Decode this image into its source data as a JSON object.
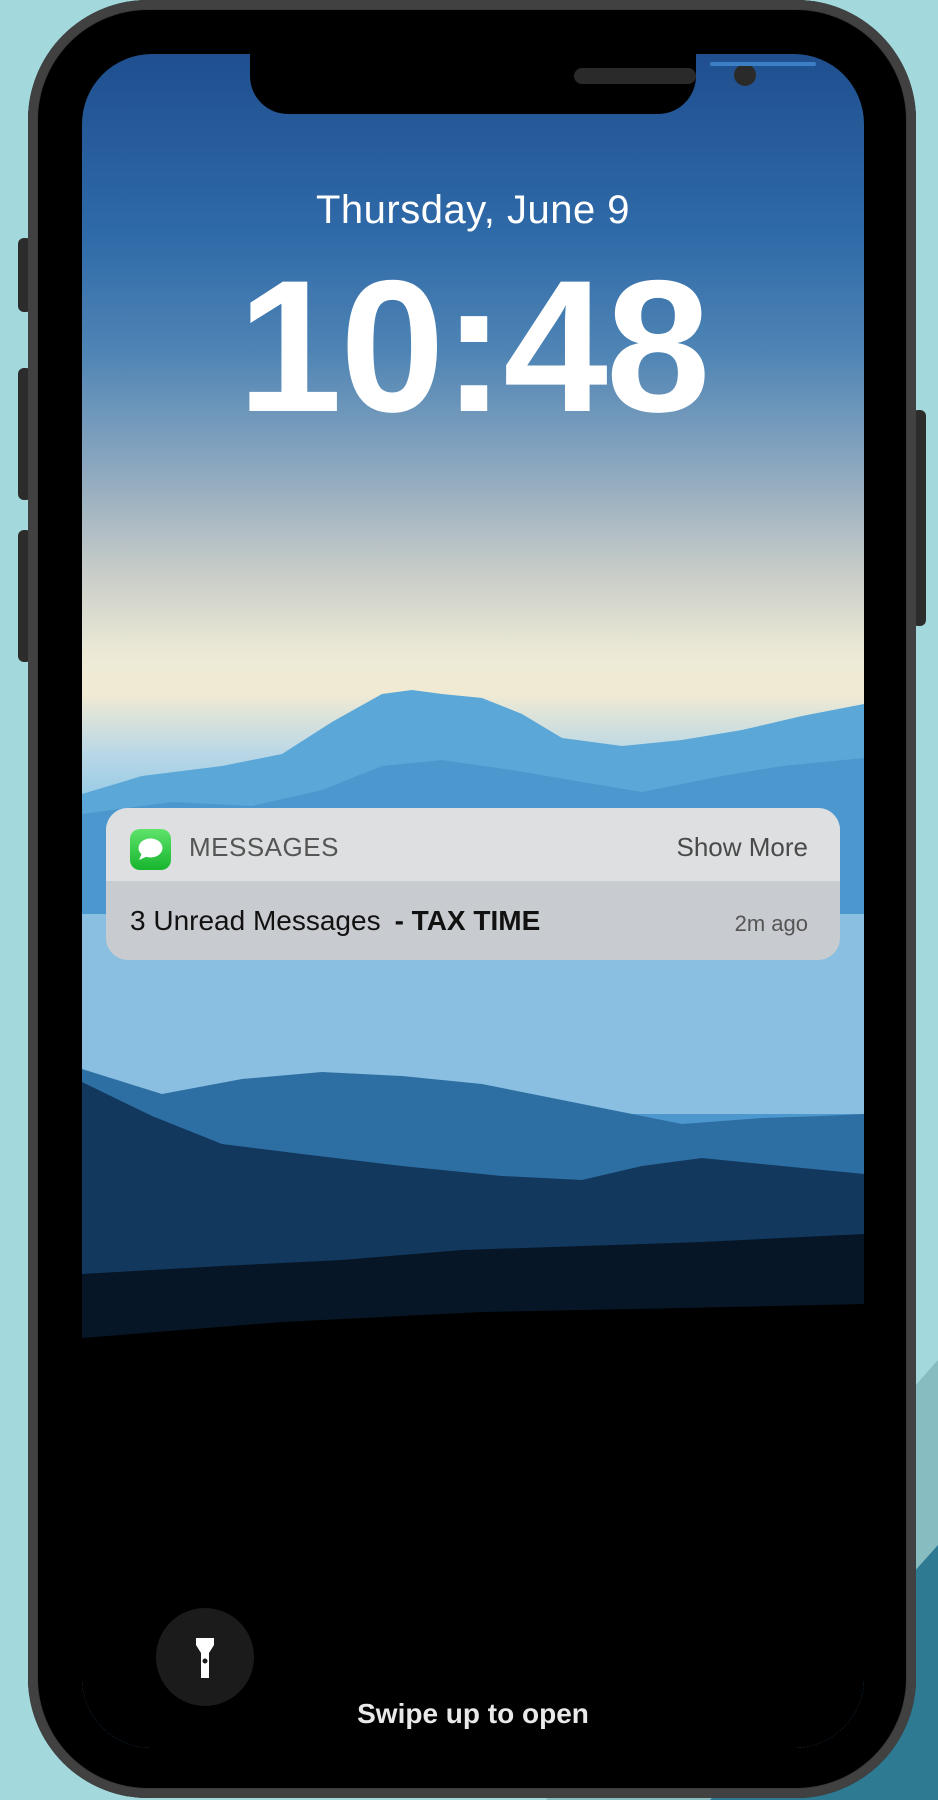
{
  "lock_screen": {
    "date": "Thursday, June 9",
    "time": "10:48",
    "swipe_hint": "Swipe up to open",
    "flashlight_icon": "flashlight-icon"
  },
  "notification": {
    "app_icon": "messages-app-icon",
    "app_name": "MESSAGES",
    "show_more_label": "Show More",
    "message": "3 Unread Messages",
    "tag": "- TAX TIME",
    "time_ago": "2m ago"
  },
  "colors": {
    "background": "#a3d8dc",
    "corner_light": "#87bcc0",
    "corner_dark": "#2e7a93",
    "messages_green": "#28c840"
  }
}
